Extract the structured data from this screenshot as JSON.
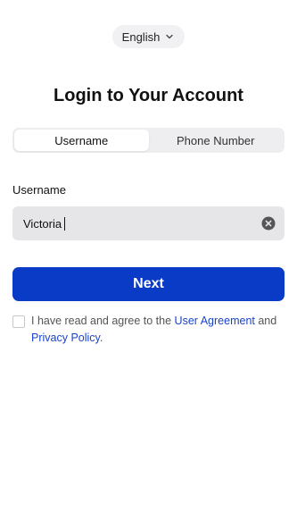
{
  "language": {
    "label": "English"
  },
  "title": "Login to Your Account",
  "tabs": [
    {
      "label": "Username",
      "active": true
    },
    {
      "label": "Phone Number",
      "active": false
    }
  ],
  "username_field": {
    "label": "Username",
    "value": "Victoria"
  },
  "next_button": {
    "label": "Next"
  },
  "agreement": {
    "prefix": "I have read and agree to the",
    "user_agreement": "User Agreement",
    "and": "and",
    "privacy_policy": "Privacy Policy",
    "suffix": "."
  },
  "colors": {
    "primary": "#0a3bc6",
    "link": "#1a44c8",
    "input_bg": "#e6e6e8",
    "tab_bg": "#eeeef0"
  },
  "icons": {
    "language_chevron": "chevron-down-icon",
    "clear": "clear-circle-icon"
  }
}
